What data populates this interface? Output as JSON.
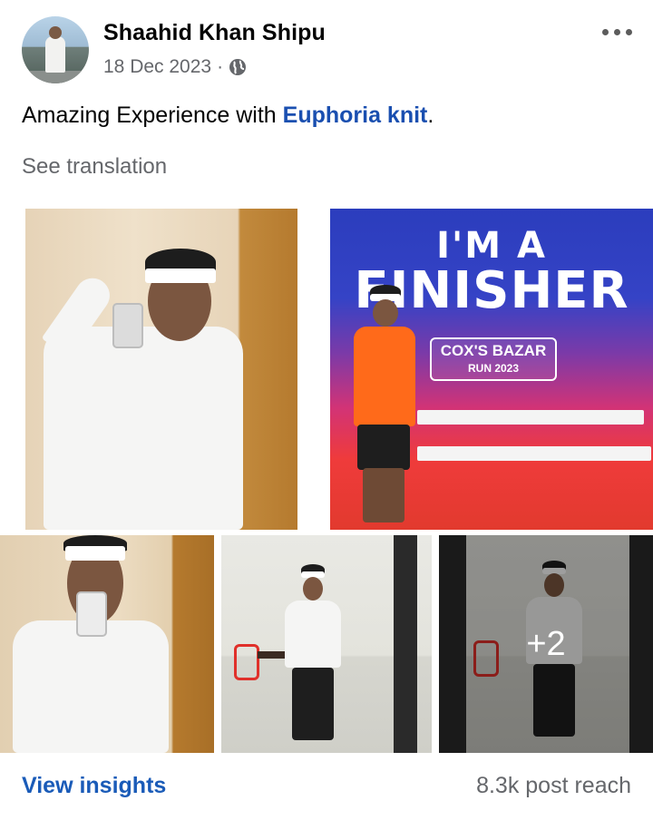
{
  "post": {
    "author": "Shaahid Khan Shipu",
    "date": "18 Dec 2023",
    "separator": "·",
    "privacy_icon": "globe-icon",
    "more_icon": "more-dots-icon",
    "text_prefix": "Amazing Experience with ",
    "text_link": "Euphoria knit",
    "text_suffix": ".",
    "see_translation": "See translation"
  },
  "photos": {
    "banner_line1": "I'M A",
    "banner_line2": "FINISHER",
    "race_name": "COX'S BAZAR",
    "race_sub": "RUN 2023",
    "more_count": "+2"
  },
  "footer": {
    "view_insights": "View insights",
    "post_reach": "8.3k post reach"
  },
  "colors": {
    "link": "#1a4fb0",
    "insights": "#1a5bb8",
    "secondary_text": "#65676b"
  }
}
